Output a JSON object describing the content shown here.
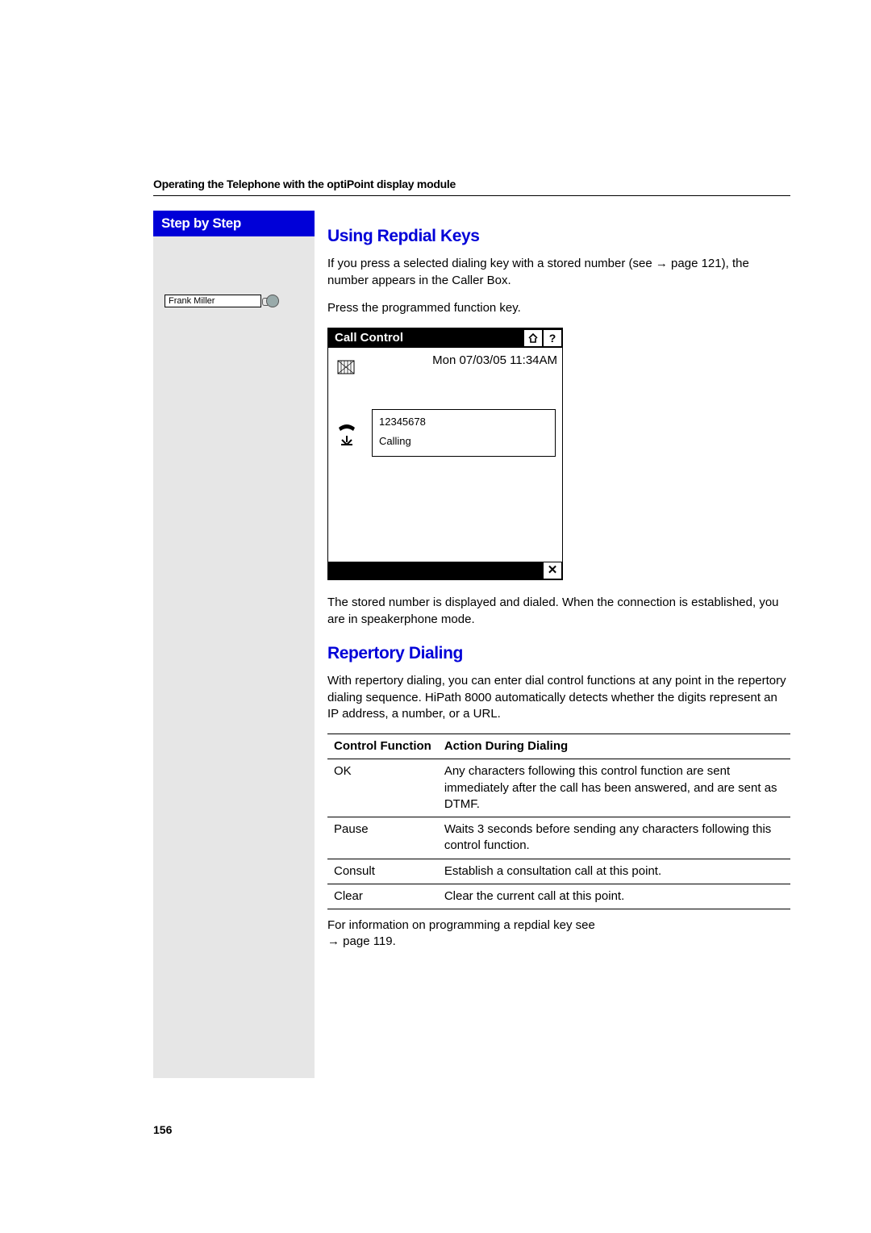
{
  "header": {
    "running": "Operating the Telephone with the optiPoint display module",
    "step_by_step": "Step by Step"
  },
  "sidebar": {
    "key_name": "Frank Miller"
  },
  "section1": {
    "title": "Using Repdial Keys",
    "p1a": "If you press a selected dialing key with a stored number (see ",
    "p1_link": "→ page 121",
    "p1b": "), the number appears in the Caller Box.",
    "p2": "Press the programmed function key.",
    "after": "The stored number is displayed and dialed. When the connection is established, you are in speakerphone mode."
  },
  "phone": {
    "title": "Call Control",
    "date": "Mon 07/03/05 11:34AM",
    "number": "12345678",
    "status": "Calling"
  },
  "section2": {
    "title": "Repertory Dialing",
    "p1": "With repertory dialing, you can enter dial control functions at any point in the repertory dialing sequence. HiPath 8000 automatically detects whether the digits represent an IP address, a number, or a URL.",
    "tbl_head_fn": "Control Function",
    "tbl_head_act": "Action During Dialing",
    "rows": [
      {
        "fn": "OK",
        "act": "Any characters following this control function are sent immediately after the call has been answered, and are sent as DTMF."
      },
      {
        "fn": "Pause",
        "act": "Waits 3 seconds before sending any characters following this control function."
      },
      {
        "fn": "Consult",
        "act": "Establish a consultation call at this point."
      },
      {
        "fn": "Clear",
        "act": "Clear the current call at this point."
      }
    ],
    "note_a": "For information on programming a repdial key see ",
    "note_link": "→ page 119",
    "note_b": "."
  },
  "page_number": "156"
}
